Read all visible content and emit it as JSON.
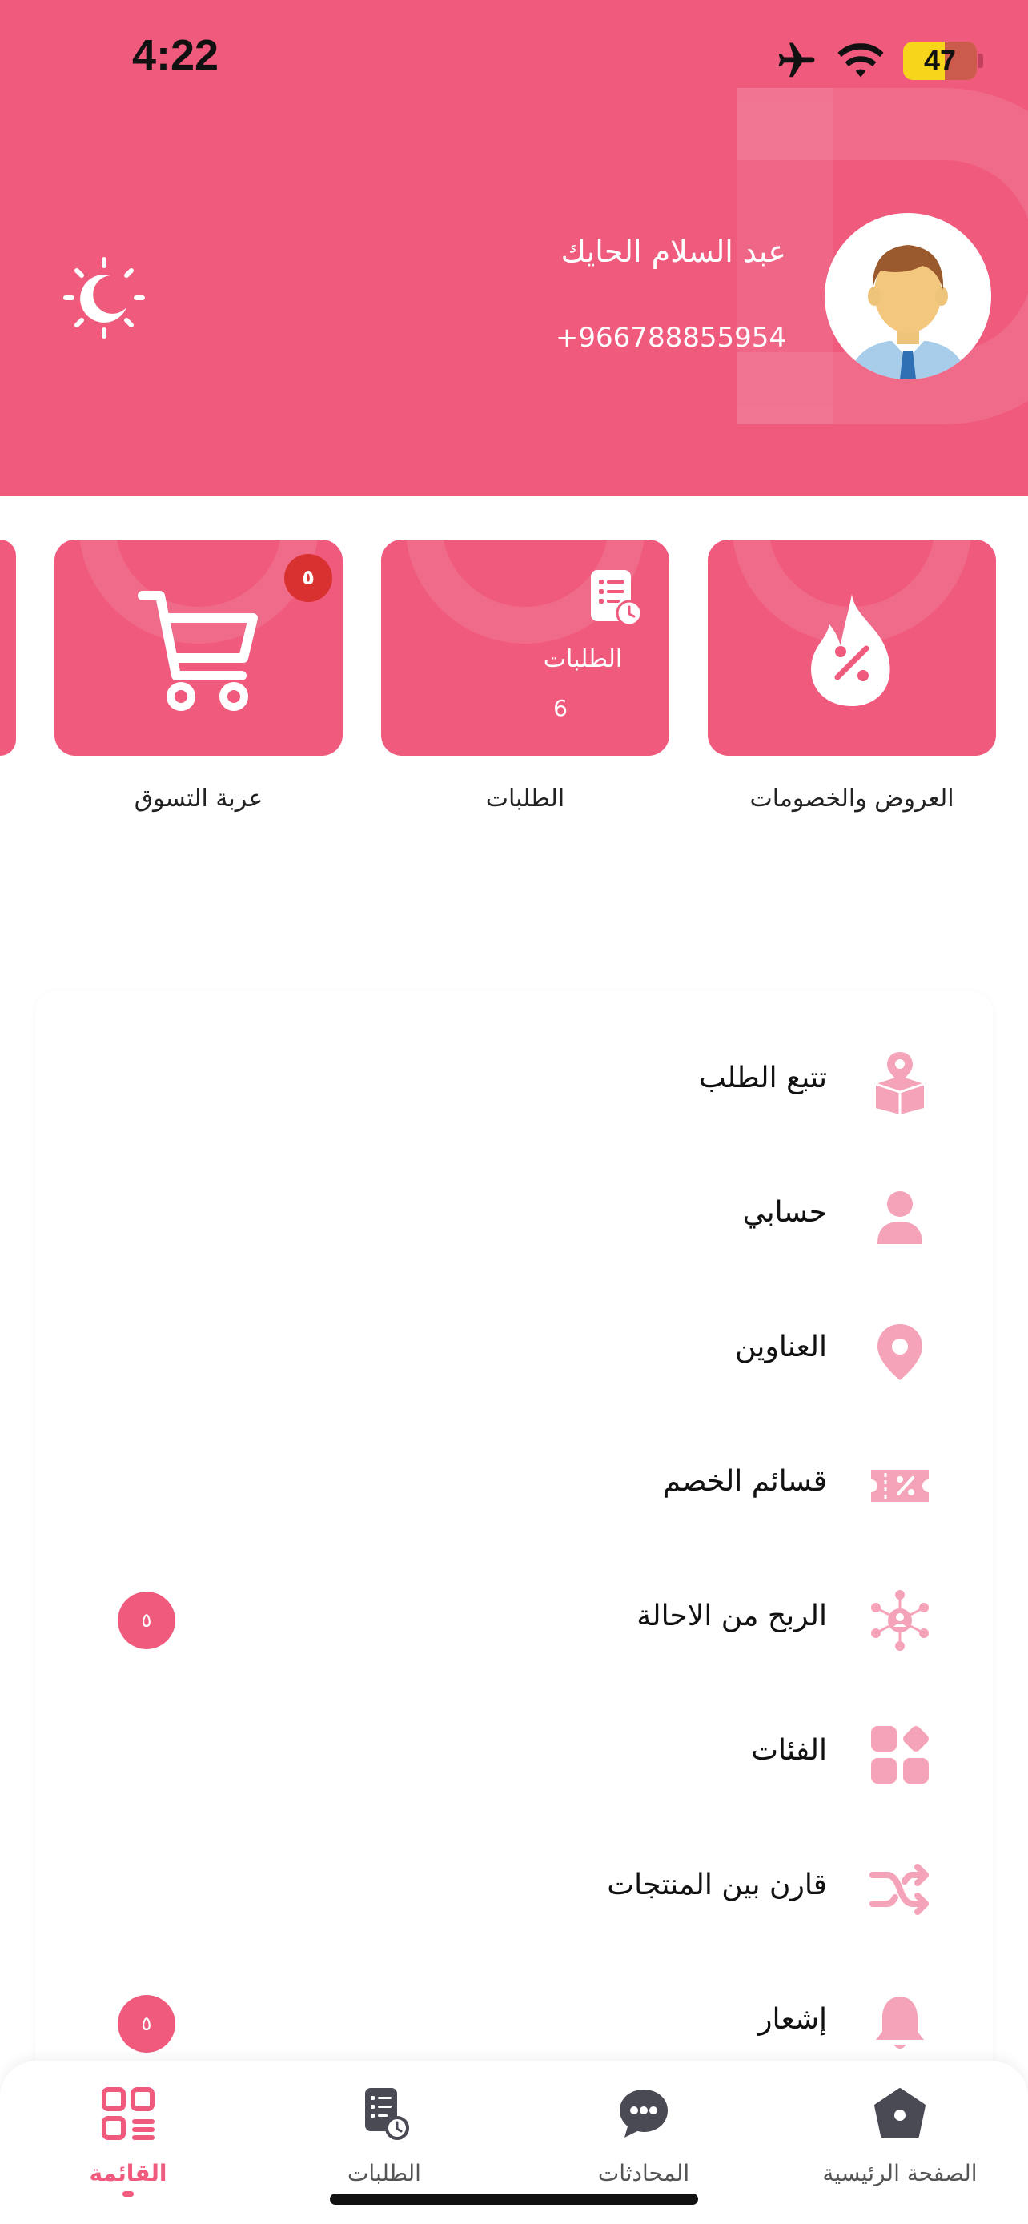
{
  "status_bar": {
    "time": "4:22",
    "battery": "47",
    "icons": [
      "airplane-icon",
      "wifi-icon",
      "battery-icon"
    ]
  },
  "profile": {
    "name": "عبد السلام الحايك",
    "phone": "+966788855954",
    "avatar": "user-avatar-illustration",
    "theme_icon": "moon-sun-icon"
  },
  "quick_cards": [
    {
      "label": "العروض والخصومات",
      "icon": "fire-discount-icon"
    },
    {
      "label": "الطلبات",
      "icon": "orders-list-icon",
      "title": "الطلبات",
      "count": "6"
    },
    {
      "label": "عربة التسوق",
      "icon": "cart-icon",
      "badge": "٥"
    }
  ],
  "menu": {
    "items": [
      {
        "label": "تتبع الطلب",
        "icon": "track-package-icon"
      },
      {
        "label": "حسابي",
        "icon": "user-icon"
      },
      {
        "label": "العناوين",
        "icon": "location-pin-icon"
      },
      {
        "label": "قسائم الخصم",
        "icon": "coupon-icon"
      },
      {
        "label": "الربح من الاحالة",
        "icon": "referral-network-icon",
        "badge": "٥"
      },
      {
        "label": "الفئات",
        "icon": "categories-grid-icon"
      },
      {
        "label": "قارن بين المنتجات",
        "icon": "compare-shuffle-icon"
      },
      {
        "label": "إشعار",
        "icon": "bell-icon",
        "badge": "٥"
      }
    ]
  },
  "bottom_nav": {
    "items": [
      {
        "label": "القائمة",
        "icon": "menu-grid-icon",
        "active": true
      },
      {
        "label": "الطلبات",
        "icon": "orders-icon"
      },
      {
        "label": "المحادثات",
        "icon": "chat-bubble-icon"
      },
      {
        "label": "الصفحة الرئيسية",
        "icon": "home-icon"
      }
    ]
  },
  "colors": {
    "accent": "#ef5a7d",
    "icon_pink": "#f5a3b8",
    "badge_red": "#d93030",
    "nav_icon": "#4a4a55"
  }
}
